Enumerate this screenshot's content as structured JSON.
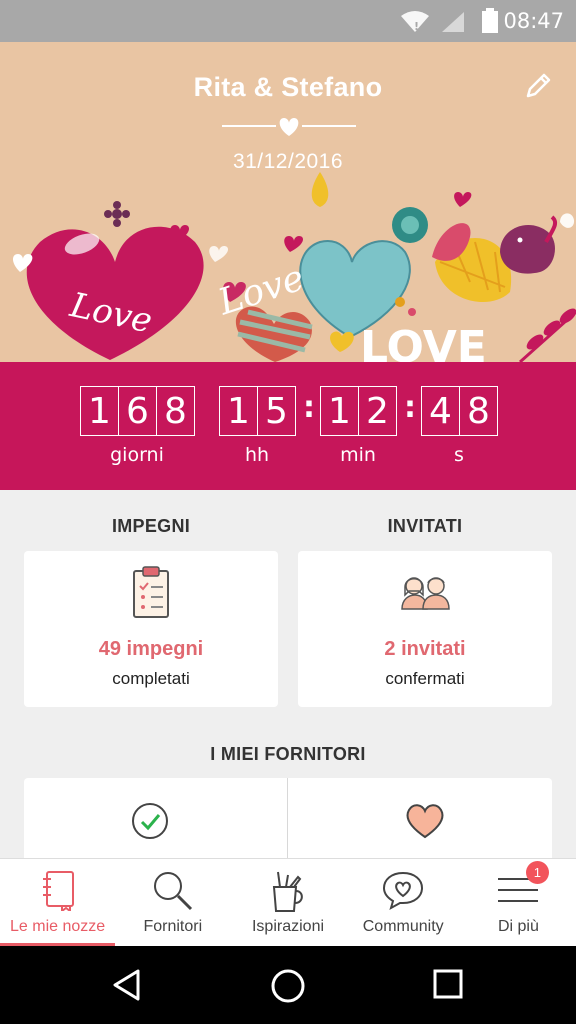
{
  "status_bar": {
    "time": "08:47"
  },
  "header": {
    "couple": "Rita & Stefano",
    "date": "31/12/2016",
    "illustration_words": [
      "Love",
      "Love",
      "LOVE"
    ]
  },
  "countdown": {
    "days": [
      "1",
      "6",
      "8"
    ],
    "hours": [
      "1",
      "5"
    ],
    "minutes": [
      "1",
      "2"
    ],
    "seconds": [
      "4",
      "8"
    ],
    "separators": [
      ":",
      ":"
    ],
    "labels": {
      "days": "giorni",
      "hours": "hh",
      "minutes": "min",
      "seconds": "s"
    }
  },
  "tasks": {
    "title": "IMPEGNI",
    "value": "49 impegni",
    "sub": "completati"
  },
  "guests": {
    "title": "INVITATI",
    "value": "2 invitati",
    "sub": "confermati"
  },
  "providers": {
    "title": "I MIEI FORNITORI"
  },
  "nav": {
    "items": [
      {
        "label": "Le mie nozze",
        "icon": "notebook-icon",
        "active": true
      },
      {
        "label": "Fornitori",
        "icon": "search-icon"
      },
      {
        "label": "Ispirazioni",
        "icon": "pencil-cup-icon"
      },
      {
        "label": "Community",
        "icon": "chat-heart-icon"
      },
      {
        "label": "Di più",
        "icon": "menu-icon",
        "badge": "1"
      }
    ]
  },
  "colors": {
    "accent": "#c6165a",
    "header_bg": "#e9c5a3",
    "highlight": "#e06870",
    "nav_active": "#e85c66"
  }
}
